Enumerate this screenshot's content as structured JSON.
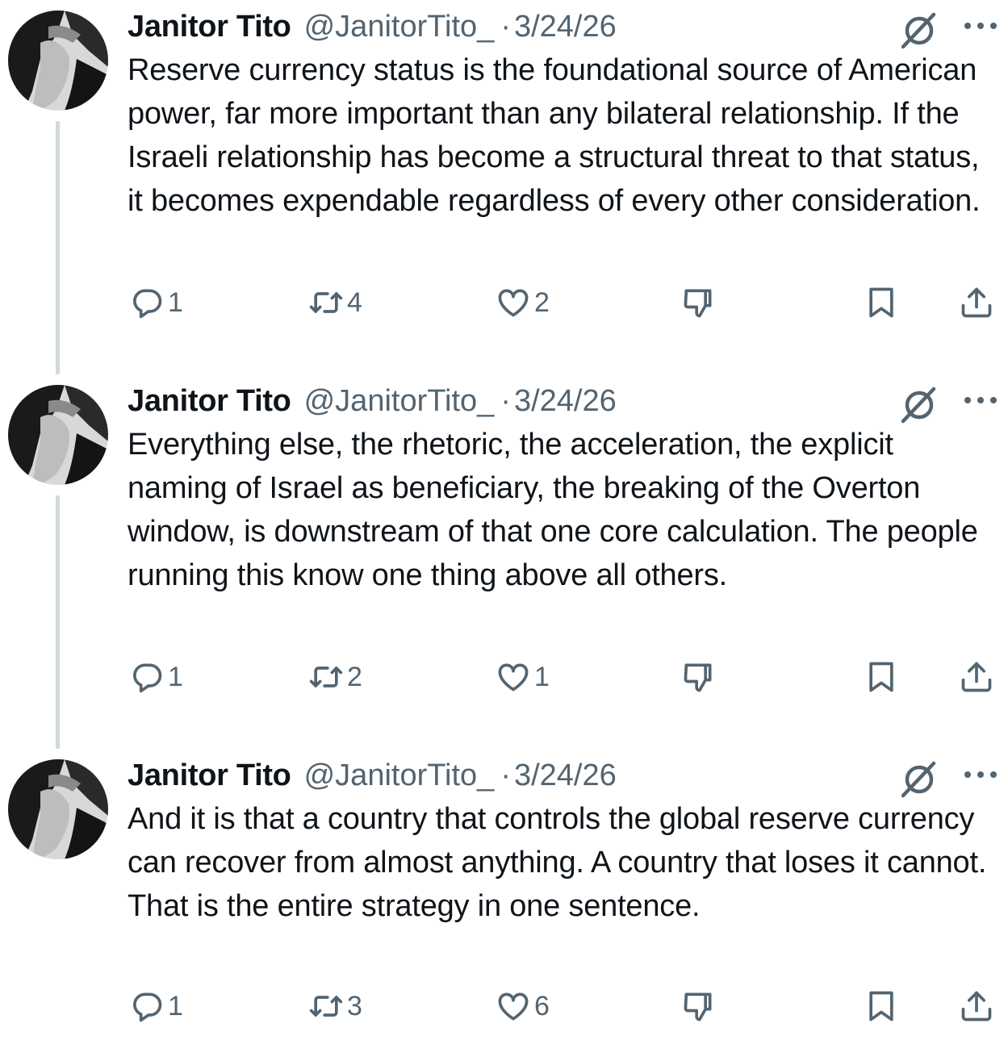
{
  "colors": {
    "text_primary": "#0f1419",
    "text_secondary": "#536471",
    "thread_line": "#cfd9de",
    "background": "#ffffff"
  },
  "tweets": [
    {
      "author": {
        "display_name": "Janitor Tito",
        "handle": "@JanitorTito_"
      },
      "separator": "·",
      "date": "3/24/26",
      "text": "Reserve currency status is the foundational source of American power, far more important than any bilateral relationship. If the Israeli relationship has become a structural threat to that status, it becomes expendable regardless of every other consideration.",
      "stats": {
        "replies": "1",
        "reposts": "4",
        "likes": "2"
      },
      "icons": [
        "avatar",
        "grok-icon",
        "more-icon",
        "reply-icon",
        "repost-icon",
        "like-icon",
        "dislike-icon",
        "bookmark-icon",
        "share-icon"
      ]
    },
    {
      "author": {
        "display_name": "Janitor Tito",
        "handle": "@JanitorTito_"
      },
      "separator": "·",
      "date": "3/24/26",
      "text": "Everything else, the rhetoric, the acceleration, the explicit naming of Israel as beneficiary, the breaking of the Overton window, is downstream of that one core calculation. The people running this know one thing above all others.",
      "stats": {
        "replies": "1",
        "reposts": "2",
        "likes": "1"
      },
      "icons": [
        "avatar",
        "grok-icon",
        "more-icon",
        "reply-icon",
        "repost-icon",
        "like-icon",
        "dislike-icon",
        "bookmark-icon",
        "share-icon"
      ]
    },
    {
      "author": {
        "display_name": "Janitor Tito",
        "handle": "@JanitorTito_"
      },
      "separator": "·",
      "date": "3/24/26",
      "text": "And it is that a country that controls the global reserve currency can recover from almost anything. A country that loses it cannot. That is the entire strategy in one sentence.",
      "stats": {
        "replies": "1",
        "reposts": "3",
        "likes": "6"
      },
      "icons": [
        "avatar",
        "grok-icon",
        "more-icon",
        "reply-icon",
        "repost-icon",
        "like-icon",
        "dislike-icon",
        "bookmark-icon",
        "share-icon"
      ]
    }
  ]
}
